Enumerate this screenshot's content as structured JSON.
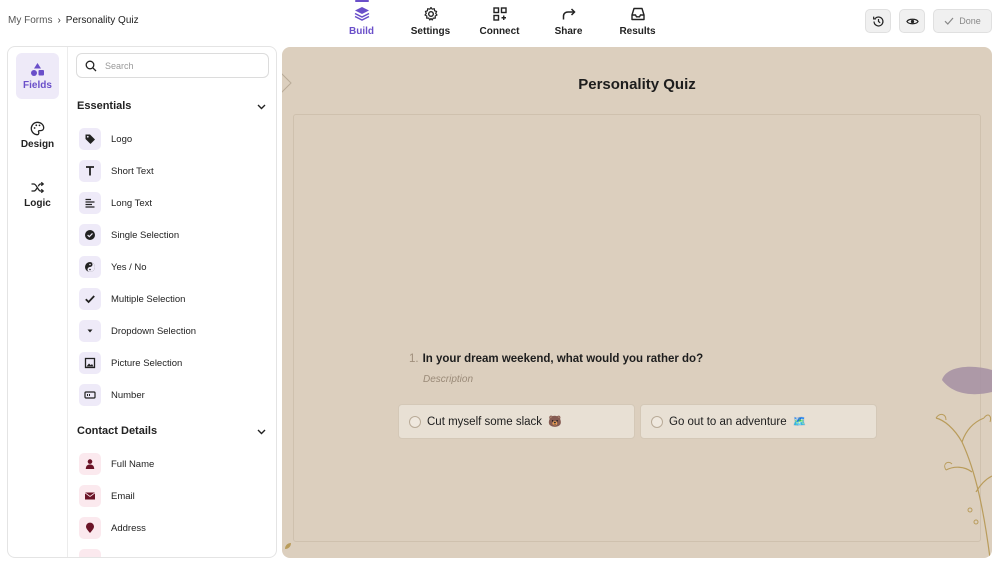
{
  "breadcrumb": {
    "parent": "My Forms",
    "separator": "›",
    "current": "Personality Quiz"
  },
  "nav": [
    {
      "label": "Build",
      "icon": "layers-icon",
      "active": true
    },
    {
      "label": "Settings",
      "icon": "gear-icon",
      "active": false
    },
    {
      "label": "Connect",
      "icon": "connect-icon",
      "active": false
    },
    {
      "label": "Share",
      "icon": "share-arrow-icon",
      "active": false
    },
    {
      "label": "Results",
      "icon": "inbox-icon",
      "active": false
    }
  ],
  "actions": {
    "done_label": "Done",
    "history_icon": "history-icon",
    "preview_icon": "eye-icon",
    "done_icon": "check-icon"
  },
  "rail": [
    {
      "label": "Fields",
      "icon": "shapes-icon",
      "active": true
    },
    {
      "label": "Design",
      "icon": "palette-icon",
      "active": false
    },
    {
      "label": "Logic",
      "icon": "shuffle-icon",
      "active": false
    }
  ],
  "search": {
    "placeholder": "Search",
    "value": ""
  },
  "sections": {
    "essentials": {
      "title": "Essentials",
      "items": [
        {
          "label": "Logo",
          "icon": "tag-icon"
        },
        {
          "label": "Short Text",
          "icon": "text-t-icon"
        },
        {
          "label": "Long Text",
          "icon": "paragraph-icon"
        },
        {
          "label": "Single Selection",
          "icon": "check-circle-icon"
        },
        {
          "label": "Yes / No",
          "icon": "yin-yang-icon"
        },
        {
          "label": "Multiple Selection",
          "icon": "checkmark-icon"
        },
        {
          "label": "Dropdown Selection",
          "icon": "dropdown-icon"
        },
        {
          "label": "Picture Selection",
          "icon": "picture-icon"
        },
        {
          "label": "Number",
          "icon": "number-icon"
        }
      ]
    },
    "contact": {
      "title": "Contact Details",
      "items": [
        {
          "label": "Full Name",
          "icon": "person-icon"
        },
        {
          "label": "Email",
          "icon": "envelope-icon"
        },
        {
          "label": "Address",
          "icon": "map-pin-icon"
        }
      ]
    }
  },
  "canvas": {
    "title": "Personality Quiz",
    "question_number": "1.",
    "question": "In your dream weekend, what would you rather do?",
    "description_placeholder": "Description",
    "options": [
      {
        "label": "Cut myself some slack",
        "emoji": "🐻"
      },
      {
        "label": "Go out to an adventure",
        "emoji": "🗺️"
      }
    ]
  },
  "colors": {
    "accent": "#6a4fc9",
    "canvas_bg": "#dccfbe",
    "option_bg": "#e8e0d4",
    "contact_icon": "#6b1427"
  }
}
